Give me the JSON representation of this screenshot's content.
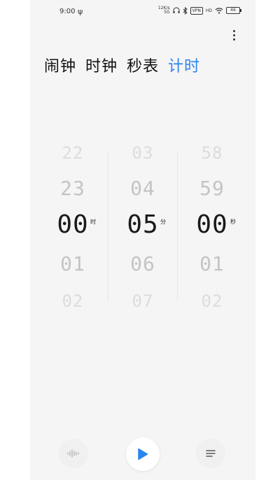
{
  "status_bar": {
    "time": "9:00",
    "speed_top": "12K/s",
    "speed_bottom": "5G",
    "vpn": "VPN",
    "hd": "HD",
    "battery": "46"
  },
  "tabs": [
    {
      "label": "闹钟"
    },
    {
      "label": "时钟"
    },
    {
      "label": "秒表"
    },
    {
      "label": "计时"
    }
  ],
  "picker": {
    "hours": {
      "far_above": "22",
      "above": "23",
      "current": "00",
      "below": "01",
      "far_below": "02",
      "unit": "时"
    },
    "minutes": {
      "far_above": "03",
      "above": "04",
      "current": "05",
      "below": "06",
      "far_below": "07",
      "unit": "分"
    },
    "seconds": {
      "far_above": "58",
      "above": "59",
      "current": "00",
      "below": "01",
      "far_below": "02",
      "unit": "秒"
    }
  },
  "colors": {
    "accent": "#2b84f0",
    "background": "#f5f5f5"
  },
  "icons": {
    "left": "sound-wave-icon",
    "center": "play-icon",
    "right": "list-icon",
    "more": "more-vertical-icon"
  }
}
